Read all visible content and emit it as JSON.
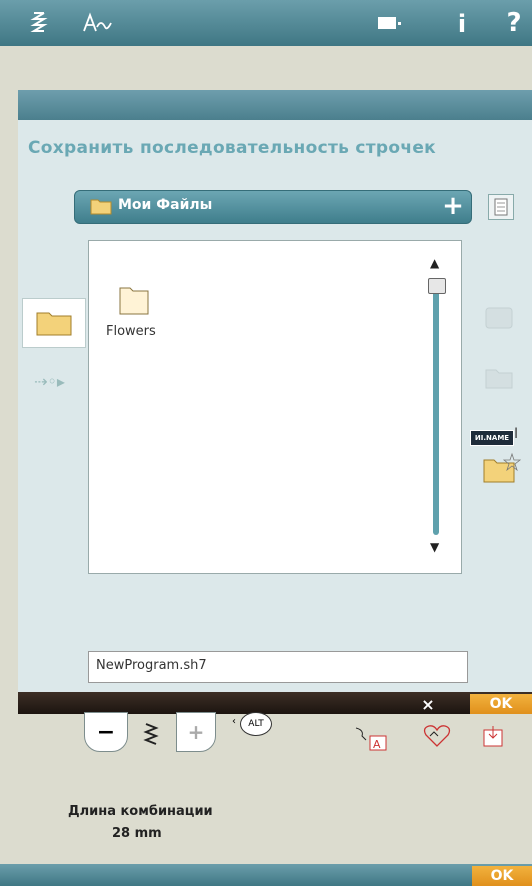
{
  "topbar": {
    "icons": [
      "stitch-menu-icon",
      "font-menu-icon",
      "file-transfer-icon",
      "info-icon",
      "help-icon"
    ],
    "info_glyph": "i",
    "help_glyph": "?"
  },
  "dialog": {
    "title": "Сохранить последовательность строчек",
    "folder_selector": "Мои Файлы",
    "files": [
      {
        "name": "Flowers",
        "type": "folder"
      }
    ],
    "filename_value": "NewProgram.sh7",
    "rename_badge": "ИІ.NAME",
    "cancel_glyph": "×",
    "ok_label": "OK"
  },
  "stitch_controls": {
    "minus_glyph": "−",
    "plus_glyph": "+",
    "alt_label": "ALT",
    "length_label": "Длина комбинации",
    "length_value": "28 mm"
  },
  "footer": {
    "ok_label": "OK"
  },
  "colors": {
    "accent": "#4b8797",
    "ok": "#e89a24",
    "title": "#6aa8b4"
  }
}
